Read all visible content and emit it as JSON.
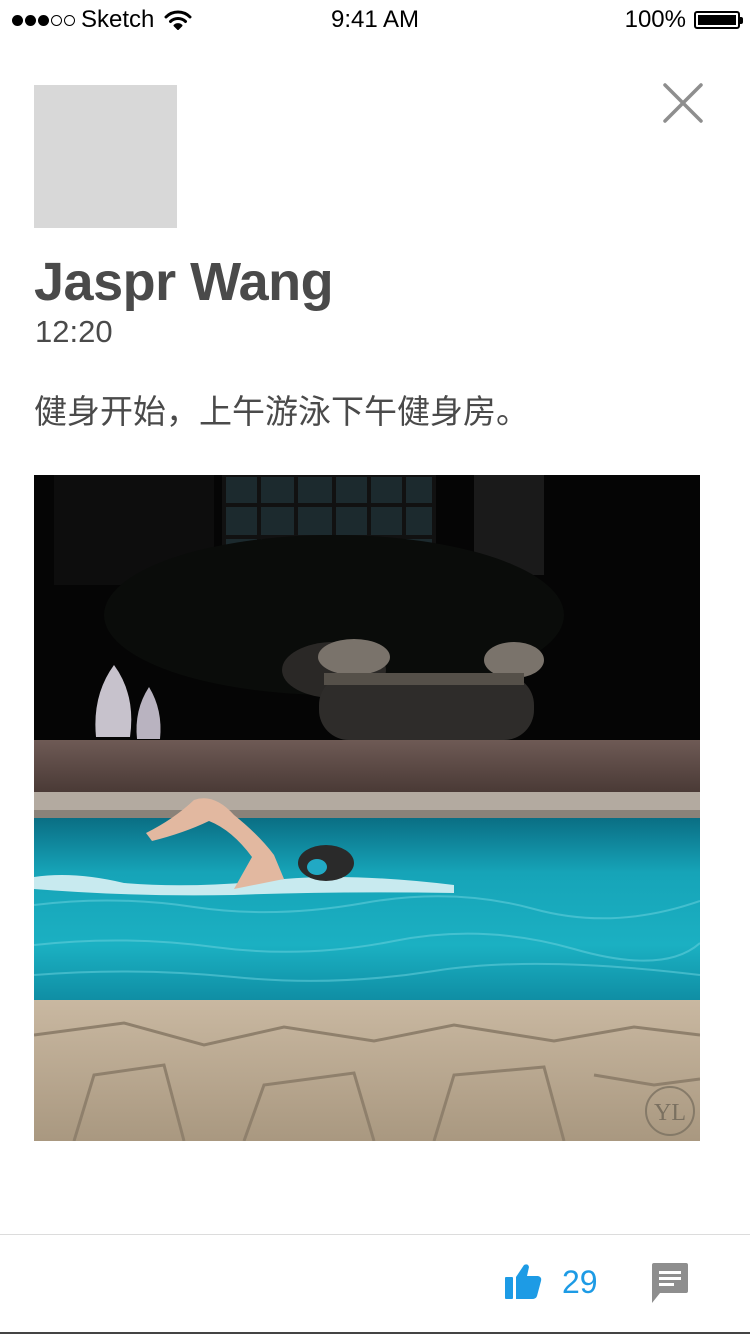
{
  "status_bar": {
    "carrier": "Sketch",
    "time": "9:41 AM",
    "battery": "100%",
    "signal_strength": 3,
    "signal_max": 5
  },
  "post": {
    "author": "Jaspr Wang",
    "time": "12:20",
    "text": "健身开始，上午游泳下午健身房。",
    "photo_icon": "photo-swimmer-in-pool",
    "watermark": "YL"
  },
  "actions": {
    "like_icon": "thumbs-up-icon",
    "like_count": "29",
    "comment_icon": "comment-icon",
    "close_icon": "close-icon"
  },
  "colors": {
    "accent": "#1d9be5",
    "text": "#4a4a4a",
    "avatar_placeholder": "#d8d8d8",
    "icon_gray": "#8e8e8e"
  }
}
